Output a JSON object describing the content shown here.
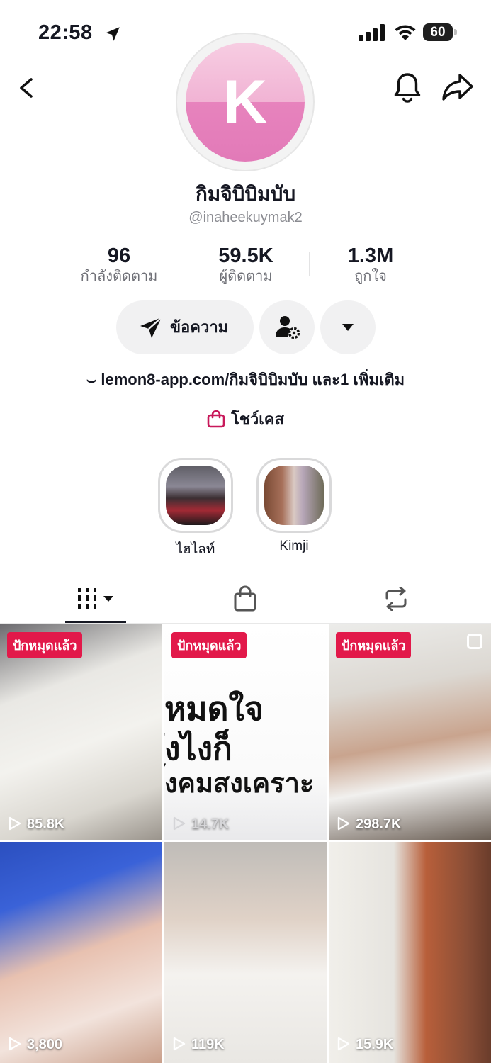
{
  "status_bar": {
    "time": "22:58",
    "battery": "60"
  },
  "profile": {
    "avatar_letter": "K",
    "display_name": "กิมจิบิบิมบับ",
    "username": "@inaheekuymak2"
  },
  "stats": [
    {
      "value": "96",
      "label": "กำลังติดตาม"
    },
    {
      "value": "59.5K",
      "label": "ผู้ติดตาม"
    },
    {
      "value": "1.3M",
      "label": "ถูกใจ"
    }
  ],
  "actions": {
    "message_label": "ข้อความ"
  },
  "bio": {
    "link_text": "lemon8-app.com/กิมจิบิบิมบับ และ1 เพิ่มเติม",
    "showcase_label": "โชว์เคส"
  },
  "highlights": [
    {
      "label": "ไฮไลท์"
    },
    {
      "label": "Kimji"
    }
  ],
  "tabs": [
    {
      "icon": "videos-grid-icon",
      "active": true
    },
    {
      "icon": "shopping-bag-icon",
      "active": false
    },
    {
      "icon": "repost-icon",
      "active": false
    }
  ],
  "videos": [
    {
      "badge": "ปักหมุดแล้ว",
      "views": "85.8K"
    },
    {
      "badge": "ปักหมุดแล้ว",
      "views": "14.7K",
      "text_lines": [
        "หมดใจ",
        "ังไงก็",
        "้งคมสงเคราะ"
      ]
    },
    {
      "badge": "ปักหมุดแล้ว",
      "views": "298.7K"
    },
    {
      "views": "3,800"
    },
    {
      "views": "119K"
    },
    {
      "views": "15.9K"
    }
  ]
}
